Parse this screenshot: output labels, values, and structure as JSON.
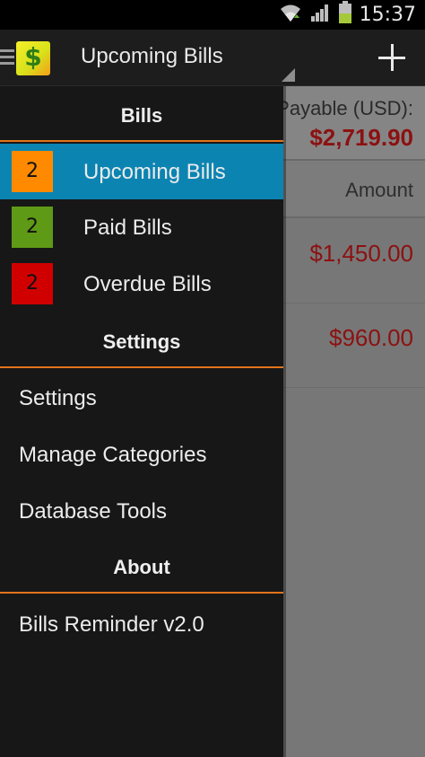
{
  "status_bar": {
    "time": "15:37",
    "icons": [
      "wifi-icon",
      "signal-icon",
      "battery-icon"
    ]
  },
  "action_bar": {
    "title": "Upcoming Bills",
    "menu_icon": "hamburger-icon",
    "logo_icon": "dollar-logo-icon",
    "add_icon": "plus-icon"
  },
  "content": {
    "payable_label": "Payable (USD):",
    "payable_value": "$2,719.90",
    "amount_header": "Amount",
    "amounts": [
      "$1,450.00",
      "$960.00"
    ]
  },
  "drawer": {
    "sections": {
      "bills": "Bills",
      "settings": "Settings",
      "about": "About"
    },
    "bill_items": [
      {
        "count": "2",
        "label": "Upcoming Bills"
      },
      {
        "count": "2",
        "label": "Paid Bills"
      },
      {
        "count": "2",
        "label": "Overdue Bills"
      }
    ],
    "settings_items": [
      "Settings",
      "Manage Categories",
      "Database Tools"
    ],
    "about_items": [
      "Bills Reminder v2.0"
    ]
  },
  "colors": {
    "accent": "#0c84b2",
    "divider": "#e3741a",
    "badge_upcoming": "#ff8a00",
    "badge_paid": "#5f9a16",
    "badge_overdue": "#d10000",
    "amount_text": "#8c1111"
  }
}
